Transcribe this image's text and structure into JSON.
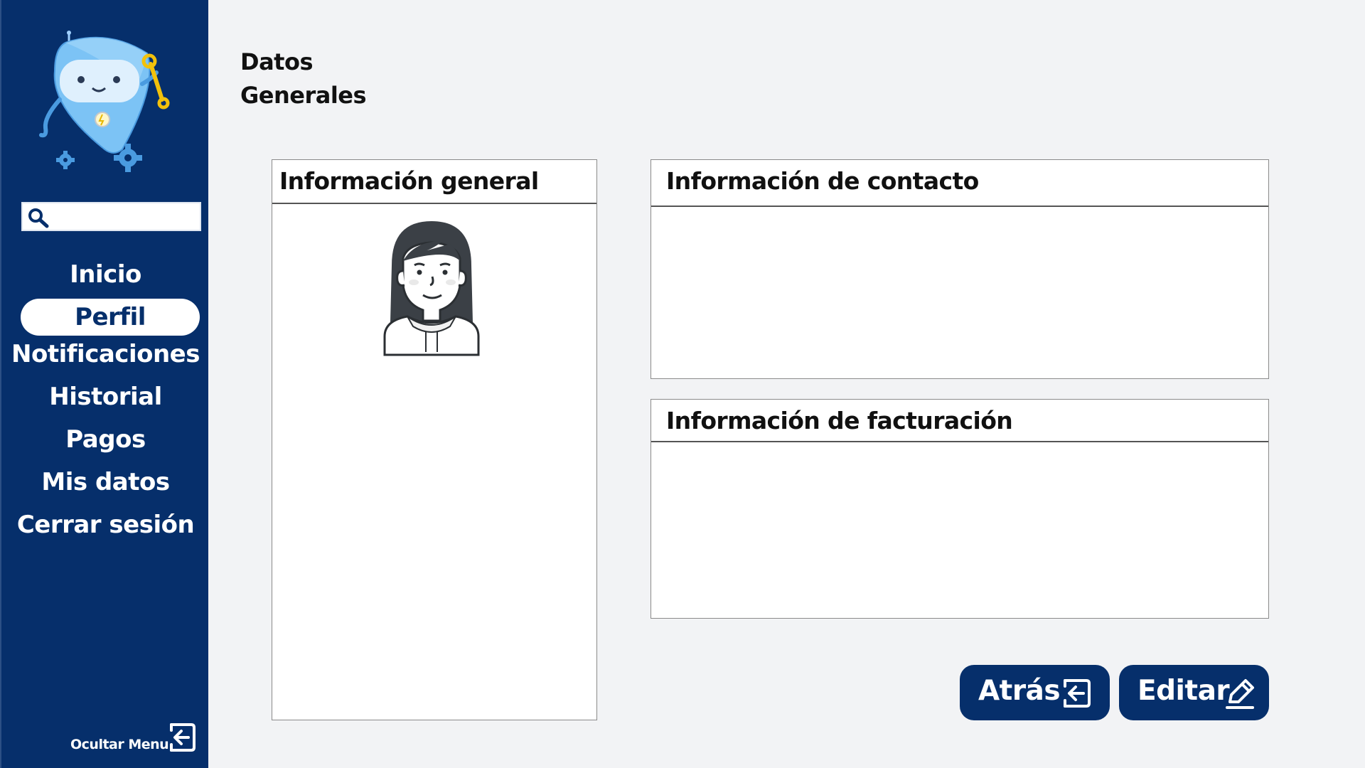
{
  "sidebar": {
    "search": {
      "placeholder": "",
      "value": ""
    },
    "items": [
      {
        "label": "Inicio",
        "active": false
      },
      {
        "label": "Perfil",
        "active": true
      },
      {
        "label": "Notificaciones",
        "active": false
      },
      {
        "label": "Historial",
        "active": false
      },
      {
        "label": "Pagos",
        "active": false
      },
      {
        "label": "Mis datos",
        "active": false
      },
      {
        "label": "Cerrar sesión",
        "active": false
      }
    ],
    "hide_menu_label": "Ocultar Menu",
    "colors": {
      "background": "#062f6b",
      "active_item_bg": "#ffffff",
      "text": "#ffffff"
    }
  },
  "page": {
    "title_line1": "Datos",
    "title_line2": "Generales"
  },
  "cards": {
    "general": {
      "title": "Información general",
      "avatar_icon": "woman-avatar-icon"
    },
    "contact": {
      "title": "Información de contacto"
    },
    "billing": {
      "title": "Información de facturación"
    }
  },
  "actions": {
    "back_label": "Atrás",
    "back_icon": "exit-arrow-icon",
    "edit_label": "Editar",
    "edit_icon": "pencil-icon"
  }
}
